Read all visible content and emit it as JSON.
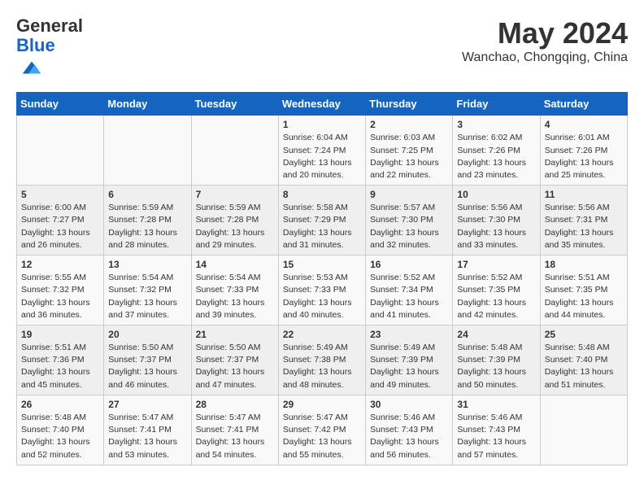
{
  "header": {
    "logo_line1": "General",
    "logo_line2": "Blue",
    "month_year": "May 2024",
    "location": "Wanchao, Chongqing, China"
  },
  "weekdays": [
    "Sunday",
    "Monday",
    "Tuesday",
    "Wednesday",
    "Thursday",
    "Friday",
    "Saturday"
  ],
  "weeks": [
    [
      {
        "day": "",
        "info": ""
      },
      {
        "day": "",
        "info": ""
      },
      {
        "day": "",
        "info": ""
      },
      {
        "day": "1",
        "info": "Sunrise: 6:04 AM\nSunset: 7:24 PM\nDaylight: 13 hours\nand 20 minutes."
      },
      {
        "day": "2",
        "info": "Sunrise: 6:03 AM\nSunset: 7:25 PM\nDaylight: 13 hours\nand 22 minutes."
      },
      {
        "day": "3",
        "info": "Sunrise: 6:02 AM\nSunset: 7:26 PM\nDaylight: 13 hours\nand 23 minutes."
      },
      {
        "day": "4",
        "info": "Sunrise: 6:01 AM\nSunset: 7:26 PM\nDaylight: 13 hours\nand 25 minutes."
      }
    ],
    [
      {
        "day": "5",
        "info": "Sunrise: 6:00 AM\nSunset: 7:27 PM\nDaylight: 13 hours\nand 26 minutes."
      },
      {
        "day": "6",
        "info": "Sunrise: 5:59 AM\nSunset: 7:28 PM\nDaylight: 13 hours\nand 28 minutes."
      },
      {
        "day": "7",
        "info": "Sunrise: 5:59 AM\nSunset: 7:28 PM\nDaylight: 13 hours\nand 29 minutes."
      },
      {
        "day": "8",
        "info": "Sunrise: 5:58 AM\nSunset: 7:29 PM\nDaylight: 13 hours\nand 31 minutes."
      },
      {
        "day": "9",
        "info": "Sunrise: 5:57 AM\nSunset: 7:30 PM\nDaylight: 13 hours\nand 32 minutes."
      },
      {
        "day": "10",
        "info": "Sunrise: 5:56 AM\nSunset: 7:30 PM\nDaylight: 13 hours\nand 33 minutes."
      },
      {
        "day": "11",
        "info": "Sunrise: 5:56 AM\nSunset: 7:31 PM\nDaylight: 13 hours\nand 35 minutes."
      }
    ],
    [
      {
        "day": "12",
        "info": "Sunrise: 5:55 AM\nSunset: 7:32 PM\nDaylight: 13 hours\nand 36 minutes."
      },
      {
        "day": "13",
        "info": "Sunrise: 5:54 AM\nSunset: 7:32 PM\nDaylight: 13 hours\nand 37 minutes."
      },
      {
        "day": "14",
        "info": "Sunrise: 5:54 AM\nSunset: 7:33 PM\nDaylight: 13 hours\nand 39 minutes."
      },
      {
        "day": "15",
        "info": "Sunrise: 5:53 AM\nSunset: 7:33 PM\nDaylight: 13 hours\nand 40 minutes."
      },
      {
        "day": "16",
        "info": "Sunrise: 5:52 AM\nSunset: 7:34 PM\nDaylight: 13 hours\nand 41 minutes."
      },
      {
        "day": "17",
        "info": "Sunrise: 5:52 AM\nSunset: 7:35 PM\nDaylight: 13 hours\nand 42 minutes."
      },
      {
        "day": "18",
        "info": "Sunrise: 5:51 AM\nSunset: 7:35 PM\nDaylight: 13 hours\nand 44 minutes."
      }
    ],
    [
      {
        "day": "19",
        "info": "Sunrise: 5:51 AM\nSunset: 7:36 PM\nDaylight: 13 hours\nand 45 minutes."
      },
      {
        "day": "20",
        "info": "Sunrise: 5:50 AM\nSunset: 7:37 PM\nDaylight: 13 hours\nand 46 minutes."
      },
      {
        "day": "21",
        "info": "Sunrise: 5:50 AM\nSunset: 7:37 PM\nDaylight: 13 hours\nand 47 minutes."
      },
      {
        "day": "22",
        "info": "Sunrise: 5:49 AM\nSunset: 7:38 PM\nDaylight: 13 hours\nand 48 minutes."
      },
      {
        "day": "23",
        "info": "Sunrise: 5:49 AM\nSunset: 7:39 PM\nDaylight: 13 hours\nand 49 minutes."
      },
      {
        "day": "24",
        "info": "Sunrise: 5:48 AM\nSunset: 7:39 PM\nDaylight: 13 hours\nand 50 minutes."
      },
      {
        "day": "25",
        "info": "Sunrise: 5:48 AM\nSunset: 7:40 PM\nDaylight: 13 hours\nand 51 minutes."
      }
    ],
    [
      {
        "day": "26",
        "info": "Sunrise: 5:48 AM\nSunset: 7:40 PM\nDaylight: 13 hours\nand 52 minutes."
      },
      {
        "day": "27",
        "info": "Sunrise: 5:47 AM\nSunset: 7:41 PM\nDaylight: 13 hours\nand 53 minutes."
      },
      {
        "day": "28",
        "info": "Sunrise: 5:47 AM\nSunset: 7:41 PM\nDaylight: 13 hours\nand 54 minutes."
      },
      {
        "day": "29",
        "info": "Sunrise: 5:47 AM\nSunset: 7:42 PM\nDaylight: 13 hours\nand 55 minutes."
      },
      {
        "day": "30",
        "info": "Sunrise: 5:46 AM\nSunset: 7:43 PM\nDaylight: 13 hours\nand 56 minutes."
      },
      {
        "day": "31",
        "info": "Sunrise: 5:46 AM\nSunset: 7:43 PM\nDaylight: 13 hours\nand 57 minutes."
      },
      {
        "day": "",
        "info": ""
      }
    ]
  ]
}
